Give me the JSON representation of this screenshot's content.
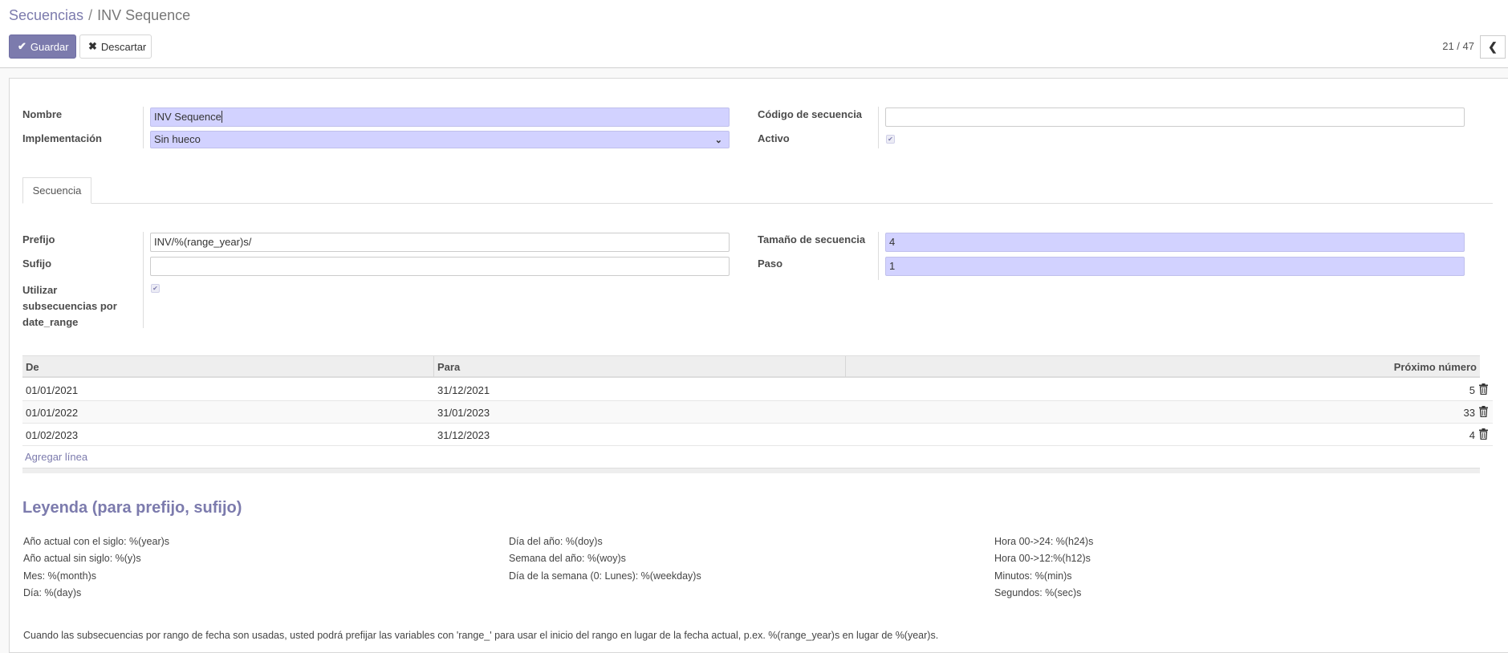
{
  "breadcrumb": {
    "parent": "Secuencias",
    "separator": "/",
    "current": "INV Sequence"
  },
  "toolbar": {
    "save_label": "Guardar",
    "discard_label": "Descartar"
  },
  "pager": {
    "value": "21 / 47"
  },
  "form": {
    "name_label": "Nombre",
    "name_value": "INV Sequence",
    "implementation_label": "Implementación",
    "implementation_value": "Sin hueco",
    "code_label": "Código de secuencia",
    "code_value": "",
    "active_label": "Activo",
    "active_checked": true
  },
  "tabs": [
    {
      "label": "Secuencia",
      "active": true
    }
  ],
  "sequence": {
    "prefix_label": "Prefijo",
    "prefix_value": "INV/%(range_year)s/",
    "suffix_label": "Sufijo",
    "suffix_value": "",
    "use_date_range_label_1": "Utilizar",
    "use_date_range_label_2": "subsecuencias por",
    "use_date_range_label_3": "date_range",
    "use_date_range_checked": true,
    "size_label": "Tamaño de secuencia",
    "size_value": "4",
    "step_label": "Paso",
    "step_value": "1"
  },
  "table": {
    "headers": {
      "from": "De",
      "to": "Para",
      "next": "Próximo número"
    },
    "rows": [
      {
        "from": "01/01/2021",
        "to": "31/12/2021",
        "next": "5"
      },
      {
        "from": "01/01/2022",
        "to": "31/01/2023",
        "next": "33"
      },
      {
        "from": "01/02/2023",
        "to": "31/12/2023",
        "next": "4"
      }
    ],
    "add_line": "Agregar línea"
  },
  "legend": {
    "title": "Leyenda (para prefijo, sufijo)",
    "col1": [
      "Año actual con el siglo: %(year)s",
      "Año actual sin siglo: %(y)s",
      "Mes: %(month)s",
      "Día: %(day)s"
    ],
    "col2": [
      "Día del año: %(doy)s",
      "Semana del año: %(woy)s",
      "Día de la semana (0: Lunes): %(weekday)s"
    ],
    "col3": [
      "Hora 00->24: %(h24)s",
      "Hora 00->12:%(h12)s",
      "Minutos: %(min)s",
      "Segundos: %(sec)s"
    ],
    "note": "Cuando las subsecuencias por rango de fecha son usadas, usted podrá prefijar las variables con 'range_' para usar el inicio del rango en lugar de la fecha actual, p.ex. %(range_year)s en lugar de %(year)s."
  },
  "icons": {
    "save": "check-icon",
    "discard": "close-icon",
    "pager_prev": "chevron-left-icon",
    "select": "chevron-down-icon",
    "delete": "trash-icon",
    "checkbox": "check-icon"
  },
  "colors": {
    "brand": "#7c7bad",
    "required_bg": "#d2d2ff"
  }
}
